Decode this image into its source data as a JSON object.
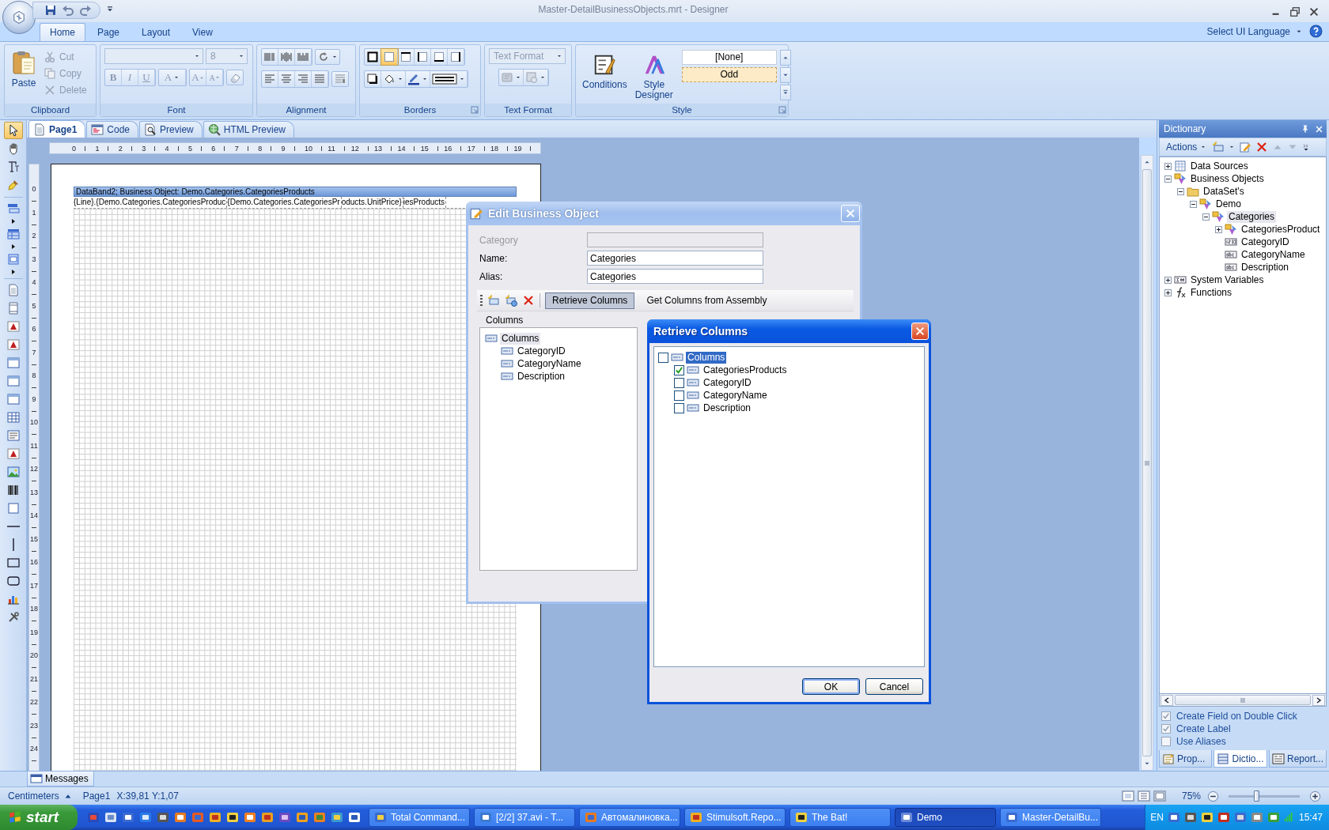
{
  "window": {
    "title": "Master-DetailBusinessObjects.mrt - Designer"
  },
  "ribbon_tabs": [
    {
      "label": "Home",
      "selected": true
    },
    {
      "label": "Page",
      "selected": false
    },
    {
      "label": "Layout",
      "selected": false
    },
    {
      "label": "View",
      "selected": false
    }
  ],
  "language_menu": {
    "label": "Select UI Language"
  },
  "ribbon": {
    "clipboard": {
      "label": "Clipboard",
      "paste": "Paste",
      "commands": [
        {
          "kind": "cut",
          "label": "Cut",
          "disabled": true
        },
        {
          "kind": "copy",
          "label": "Copy",
          "disabled": true
        },
        {
          "kind": "delete",
          "label": "Delete",
          "disabled": true
        }
      ]
    },
    "font": {
      "label": "Font",
      "size": "8",
      "buttons": [
        {
          "kind": "bold",
          "glyph": "B"
        },
        {
          "kind": "italic",
          "glyph": "I"
        },
        {
          "kind": "underline",
          "glyph": "U"
        },
        {
          "kind": "color",
          "glyph": "A"
        },
        {
          "kind": "grow",
          "glyph": "A"
        },
        {
          "kind": "shrink",
          "glyph": "A"
        }
      ]
    },
    "alignment": {
      "label": "Alignment"
    },
    "borders": {
      "label": "Borders",
      "toggles": [
        {
          "selected": false
        },
        {
          "selected": true
        },
        {
          "selected": false
        },
        {
          "selected": false
        },
        {
          "selected": false
        },
        {
          "selected": false
        }
      ]
    },
    "text_format": {
      "label": "Text Format",
      "format": "Text Format"
    },
    "style": {
      "label": "Style",
      "commands": [
        {
          "kind": "conditions",
          "label": "Conditions"
        },
        {
          "kind": "designer",
          "label": "Style Designer"
        }
      ],
      "styles": [
        {
          "label": "[None]",
          "selected": false
        },
        {
          "label": "Odd",
          "selected": true
        }
      ]
    }
  },
  "toolbox": [
    [
      {
        "kind": "pointer",
        "selected": true
      },
      {
        "kind": "hand",
        "selected": false
      },
      {
        "kind": "text-tool",
        "selected": false
      },
      {
        "kind": "brush",
        "selected": false
      }
    ],
    [
      {
        "kind": "band",
        "selected": false
      },
      {
        "kind": "band-list",
        "selected": false
      },
      {
        "kind": "band-cross",
        "selected": false
      }
    ],
    [
      {
        "kind": "page",
        "selected": false
      },
      {
        "kind": "page-lines",
        "selected": false
      },
      {
        "kind": "label",
        "selected": false
      },
      {
        "kind": "label",
        "selected": false
      },
      {
        "kind": "panel",
        "selected": false
      },
      {
        "kind": "panel",
        "selected": false
      },
      {
        "kind": "panel",
        "selected": false
      },
      {
        "kind": "table",
        "selected": false
      },
      {
        "kind": "list",
        "selected": false
      },
      {
        "kind": "label",
        "selected": false
      },
      {
        "kind": "image",
        "selected": false
      },
      {
        "kind": "barcode",
        "selected": false
      },
      {
        "kind": "box",
        "selected": false
      },
      {
        "kind": "hline",
        "selected": false
      },
      {
        "kind": "vline",
        "selected": false
      },
      {
        "kind": "rectangle",
        "selected": false
      },
      {
        "kind": "rounded",
        "selected": false
      },
      {
        "kind": "chart",
        "selected": false
      },
      {
        "kind": "tools",
        "selected": false
      }
    ]
  ],
  "document_tabs": [
    {
      "kind": "page",
      "label": "Page1",
      "selected": true
    },
    {
      "kind": "code",
      "label": "Code",
      "selected": false
    },
    {
      "kind": "preview",
      "label": "Preview",
      "selected": false
    },
    {
      "kind": "html",
      "label": "HTML Preview",
      "selected": false
    }
  ],
  "ruler": [
    "0",
    "1",
    "2",
    "3",
    "4",
    "5",
    "6",
    "7",
    "8",
    "9",
    "10",
    "11",
    "12",
    "13",
    "14",
    "15",
    "16",
    "17",
    "18",
    "19"
  ],
  "vertical_ruler": [
    "0",
    "1",
    "2",
    "3",
    "4",
    "5",
    "6",
    "7",
    "8",
    "9",
    "10",
    "11",
    "12",
    "13",
    "14",
    "15",
    "16",
    "17",
    "18",
    "19",
    "20",
    "21",
    "22",
    "23",
    "24"
  ],
  "data_band": {
    "title": "DataBand2; Business Object: Demo.Categories.CategoriesProducts",
    "cells": [
      "{Line}.{Demo.Categories.CategoriesProduc",
      "{Demo.Categories.CategoriesPr",
      "oducts.UnitPrice}",
      "iesProducts"
    ]
  },
  "dictionary": {
    "title": "Dictionary",
    "actions": "Actions",
    "tree": [
      {
        "label": "Data Sources",
        "kind": "datasource",
        "expanded": false,
        "selected": false
      },
      {
        "label": "Business Objects",
        "kind": "business-object",
        "expanded": true,
        "selected": false,
        "children": [
          {
            "label": "DataSet's",
            "kind": "folder",
            "expanded": true,
            "selected": false,
            "children": [
              {
                "label": "Demo",
                "kind": "business-object",
                "expanded": true,
                "selected": false,
                "children": [
                  {
                    "label": "Categories",
                    "kind": "business-object",
                    "expanded": true,
                    "selected": true,
                    "children": [
                      {
                        "label": "CategoriesProduct",
                        "kind": "business-object",
                        "expanded": false,
                        "selected": false
                      },
                      {
                        "label": "CategoryID",
                        "kind": "number",
                        "selected": false
                      },
                      {
                        "label": "CategoryName",
                        "kind": "text",
                        "selected": false
                      },
                      {
                        "label": "Description",
                        "kind": "text",
                        "selected": false
                      }
                    ]
                  }
                ]
              }
            ]
          }
        ]
      },
      {
        "label": "System Variables",
        "kind": "variables",
        "expanded": false,
        "selected": false
      },
      {
        "label": "Functions",
        "kind": "functions",
        "expanded": false,
        "selected": false
      }
    ],
    "options": [
      {
        "label": "Create Field on Double Click",
        "checked": true
      },
      {
        "label": "Create Label",
        "checked": true
      },
      {
        "label": "Use Aliases",
        "checked": false
      }
    ],
    "tabs": [
      {
        "kind": "properties",
        "label": "Prop...",
        "selected": false
      },
      {
        "kind": "dictionary",
        "label": "Dictio...",
        "selected": true
      },
      {
        "kind": "report",
        "label": "Report...",
        "selected": false
      }
    ]
  },
  "messages_tab": {
    "label": "Messages"
  },
  "status_bar": {
    "units": "Centimeters",
    "page": "Page1",
    "position": "X:39,81 Y:1,07",
    "zoom": "75%",
    "zoom_slider": {
      "level": 0.39
    }
  },
  "edit_dialog": {
    "title": "Edit Business Object",
    "fields": [
      {
        "label": "Category",
        "disabled": true
      },
      {
        "label": "Name:",
        "value": "Categories",
        "disabled": false
      },
      {
        "label": "Alias:",
        "value": "Categories",
        "disabled": false
      }
    ],
    "buttons": [
      {
        "label": "Retrieve Columns",
        "selected": true
      },
      {
        "label": "Get Columns from Assembly",
        "selected": false
      }
    ],
    "group": "Columns",
    "columns": [
      {
        "label": "Columns",
        "selected": true,
        "children": [
          {
            "label": "CategoryID",
            "selected": false
          },
          {
            "label": "CategoryName",
            "selected": false
          },
          {
            "label": "Description",
            "selected": false
          }
        ]
      }
    ]
  },
  "retrieve_dialog": {
    "title": "Retrieve Columns",
    "columns": [
      {
        "label": "Columns",
        "checked": false,
        "selected": true,
        "children": [
          {
            "label": "CategoriesProducts",
            "checked": true,
            "selected": false
          },
          {
            "label": "CategoryID",
            "checked": false,
            "selected": false
          },
          {
            "label": "CategoryName",
            "checked": false,
            "selected": false
          },
          {
            "label": "Description",
            "checked": false,
            "selected": false
          }
        ]
      }
    ],
    "buttons": [
      {
        "label": "OK",
        "default": true
      },
      {
        "label": "Cancel",
        "default": false
      }
    ]
  },
  "taskbar": {
    "start": "start",
    "tasks": [
      {
        "label": "Total Command...",
        "selected": false
      },
      {
        "label": "[2/2] 37.avi - T...",
        "selected": false
      },
      {
        "label": "Автомалиновка...",
        "selected": false
      },
      {
        "label": "Stimulsoft.Repo...",
        "selected": false
      },
      {
        "label": "The Bat!",
        "selected": false
      },
      {
        "label": "Demo",
        "selected": true
      },
      {
        "label": "Master-DetailBu...",
        "selected": false
      }
    ],
    "language": "EN",
    "clock": "15:47"
  }
}
